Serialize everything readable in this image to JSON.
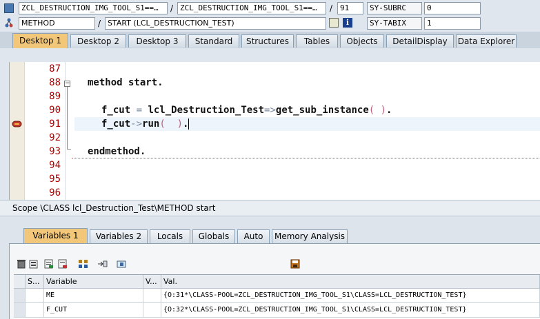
{
  "header": {
    "program_a": "ZCL_DESTRUCTION_IMG_TOOL_S1==…",
    "program_b": "ZCL_DESTRUCTION_IMG_TOOL_S1==…",
    "line_number": "91",
    "sysvar1_name": "SY-SUBRC",
    "sysvar1_value": "0",
    "event_type": "METHOD",
    "event_name": "START (LCL_DESTRUCTION_TEST)",
    "sysvar2_name": "SY-TABIX",
    "sysvar2_value": "1",
    "separator": "/"
  },
  "desktop_tabs": [
    {
      "label": "Desktop 1",
      "active": true
    },
    {
      "label": "Desktop 2",
      "active": false
    },
    {
      "label": "Desktop 3",
      "active": false
    },
    {
      "label": "Standard",
      "active": false
    },
    {
      "label": "Structures",
      "active": false
    },
    {
      "label": "Tables",
      "active": false
    },
    {
      "label": "Objects",
      "active": false
    },
    {
      "label": "DetailDisplay",
      "active": false
    },
    {
      "label": "Data Explorer",
      "active": false
    }
  ],
  "editor": {
    "line_numbers": [
      "87",
      "88",
      "89",
      "90",
      "91",
      "92",
      "93",
      "94",
      "95",
      "96"
    ],
    "collapse_marker": "−",
    "lines": {
      "l88": "method start.",
      "l90_a": "f_cut",
      "l90_eq": " = ",
      "l90_b": "lcl_Destruction_Test",
      "l90_arrow": "=>",
      "l90_c": "get_sub_instance",
      "l90_open": "( ",
      "l90_close": ")",
      "l90_dot": ".",
      "l91_a": "f_cut",
      "l91_arrow": "->",
      "l91_b": "run",
      "l91_open": "(  ",
      "l91_close": ")",
      "l91_dot": ".",
      "l93": "endmethod."
    },
    "breakpoint_line": "91"
  },
  "scope": "Scope \\CLASS lcl_Destruction_Test\\METHOD start",
  "variable_tabs": [
    {
      "label": "Variables 1",
      "active": true
    },
    {
      "label": "Variables 2",
      "active": false
    },
    {
      "label": "Locals",
      "active": false
    },
    {
      "label": "Globals",
      "active": false
    },
    {
      "label": "Auto",
      "active": false
    },
    {
      "label": "Memory Analysis",
      "active": false
    }
  ],
  "toolbar_icons": [
    "delete-icon",
    "delete-all-icon",
    "export-icon",
    "import-icon",
    "tree-icon",
    "move-icon",
    "info-icon",
    "save-icon"
  ],
  "grid": {
    "headers": {
      "s": "S...",
      "variable": "Variable",
      "v": "V...",
      "value": "Val."
    },
    "rows": [
      {
        "variable": "ME",
        "value": "{O:31*\\CLASS-POOL=ZCL_DESTRUCTION_IMG_TOOL_S1\\CLASS=LCL_DESTRUCTION_TEST}"
      },
      {
        "variable": "F_CUT",
        "value": "{O:32*\\CLASS-POOL=ZCL_DESTRUCTION_IMG_TOOL_S1\\CLASS=LCL_DESTRUCTION_TEST}"
      }
    ]
  },
  "colors": {
    "accent_tab": "#f2c77a",
    "line_number": "#b00000",
    "breakpoint": "#c0392b"
  }
}
